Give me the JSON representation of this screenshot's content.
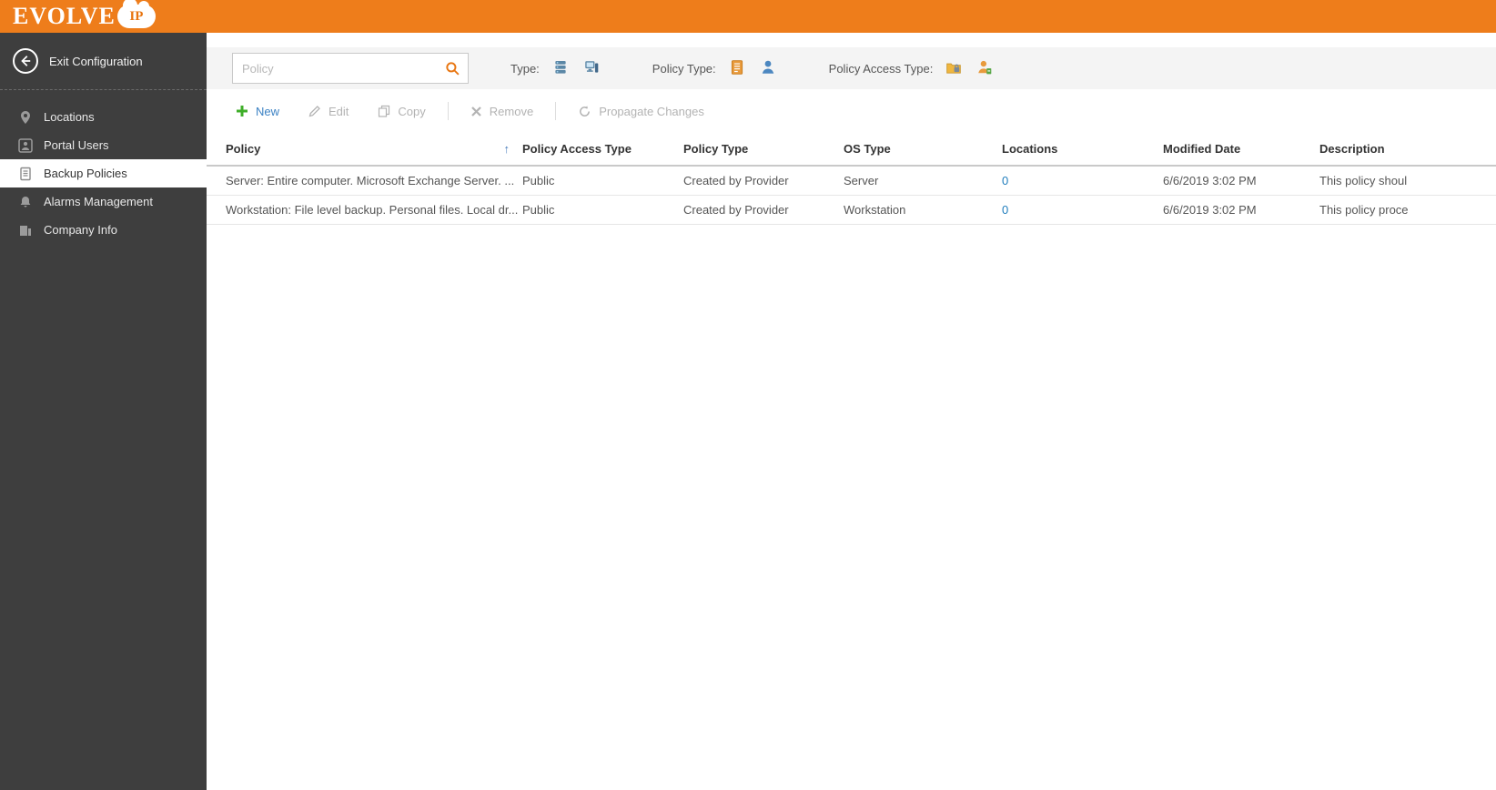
{
  "brand": {
    "name": "EVOLVE",
    "badge": "IP"
  },
  "colors": {
    "accent_orange": "#EE7D1B",
    "sidebar_dark": "#3E3E3E",
    "link_blue": "#217EBD",
    "new_green": "#3FAE29"
  },
  "sidebar": {
    "exit_label": "Exit Configuration",
    "items": [
      {
        "label": "Locations",
        "icon": "location-pin-icon",
        "selected": false
      },
      {
        "label": "Portal Users",
        "icon": "portal-user-icon",
        "selected": false
      },
      {
        "label": "Backup Policies",
        "icon": "backup-policies-icon",
        "selected": true
      },
      {
        "label": "Alarms Management",
        "icon": "alarms-icon",
        "selected": false
      },
      {
        "label": "Company Info",
        "icon": "company-info-icon",
        "selected": false
      }
    ]
  },
  "filters": {
    "search_placeholder": "Policy",
    "type_label": "Type:",
    "policy_type_label": "Policy Type:",
    "policy_access_type_label": "Policy Access Type:"
  },
  "toolbar": {
    "new_label": "New",
    "edit_label": "Edit",
    "copy_label": "Copy",
    "remove_label": "Remove",
    "propagate_label": "Propagate Changes"
  },
  "table": {
    "sort_indicator": "↑",
    "columns": [
      "Policy",
      "Policy Access Type",
      "Policy Type",
      "OS Type",
      "Locations",
      "Modified Date",
      "Description"
    ],
    "rows": [
      {
        "policy": "Server: Entire computer. Microsoft Exchange Server. ...",
        "access": "Public",
        "type": "Created by Provider",
        "os": "Server",
        "locations": "0",
        "modified": "6/6/2019 3:02 PM",
        "description": "This policy shoul"
      },
      {
        "policy": "Workstation: File level backup. Personal files. Local dr...",
        "access": "Public",
        "type": "Created by Provider",
        "os": "Workstation",
        "locations": "0",
        "modified": "6/6/2019 3:02 PM",
        "description": "This policy proce"
      }
    ]
  }
}
